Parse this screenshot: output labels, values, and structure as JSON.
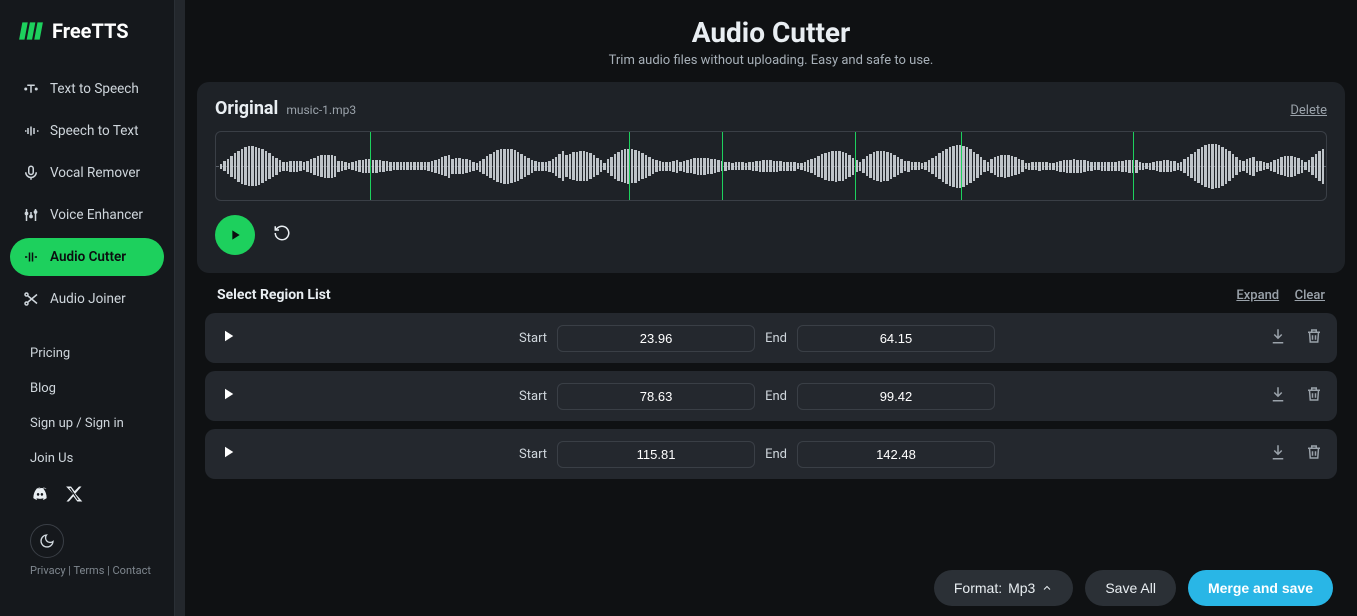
{
  "brand": "FreeTTS",
  "sidebar": {
    "items": [
      {
        "label": "Text to Speech",
        "active": false
      },
      {
        "label": "Speech to Text",
        "active": false
      },
      {
        "label": "Vocal Remover",
        "active": false
      },
      {
        "label": "Voice Enhancer",
        "active": false
      },
      {
        "label": "Audio Cutter",
        "active": true
      },
      {
        "label": "Audio Joiner",
        "active": false
      }
    ],
    "links": {
      "pricing": "Pricing",
      "blog": "Blog",
      "auth": "Sign up / Sign in",
      "join": "Join Us"
    },
    "footer": "Privacy | Terms | Contact"
  },
  "page": {
    "title": "Audio Cutter",
    "subtitle": "Trim audio files without uploading. Easy and safe to use."
  },
  "original": {
    "label": "Original",
    "filename": "music-1.mp3",
    "delete": "Delete"
  },
  "region_list": {
    "title": "Select Region List",
    "expand": "Expand",
    "clear": "Clear",
    "start_label": "Start",
    "end_label": "End",
    "regions": [
      {
        "start": "23.96",
        "end": "64.15"
      },
      {
        "start": "78.63",
        "end": "99.42"
      },
      {
        "start": "115.81",
        "end": "142.48"
      }
    ]
  },
  "footer_bar": {
    "format_prefix": "Format: ",
    "format_value": "Mp3",
    "save_all": "Save All",
    "merge": "Merge and save"
  }
}
